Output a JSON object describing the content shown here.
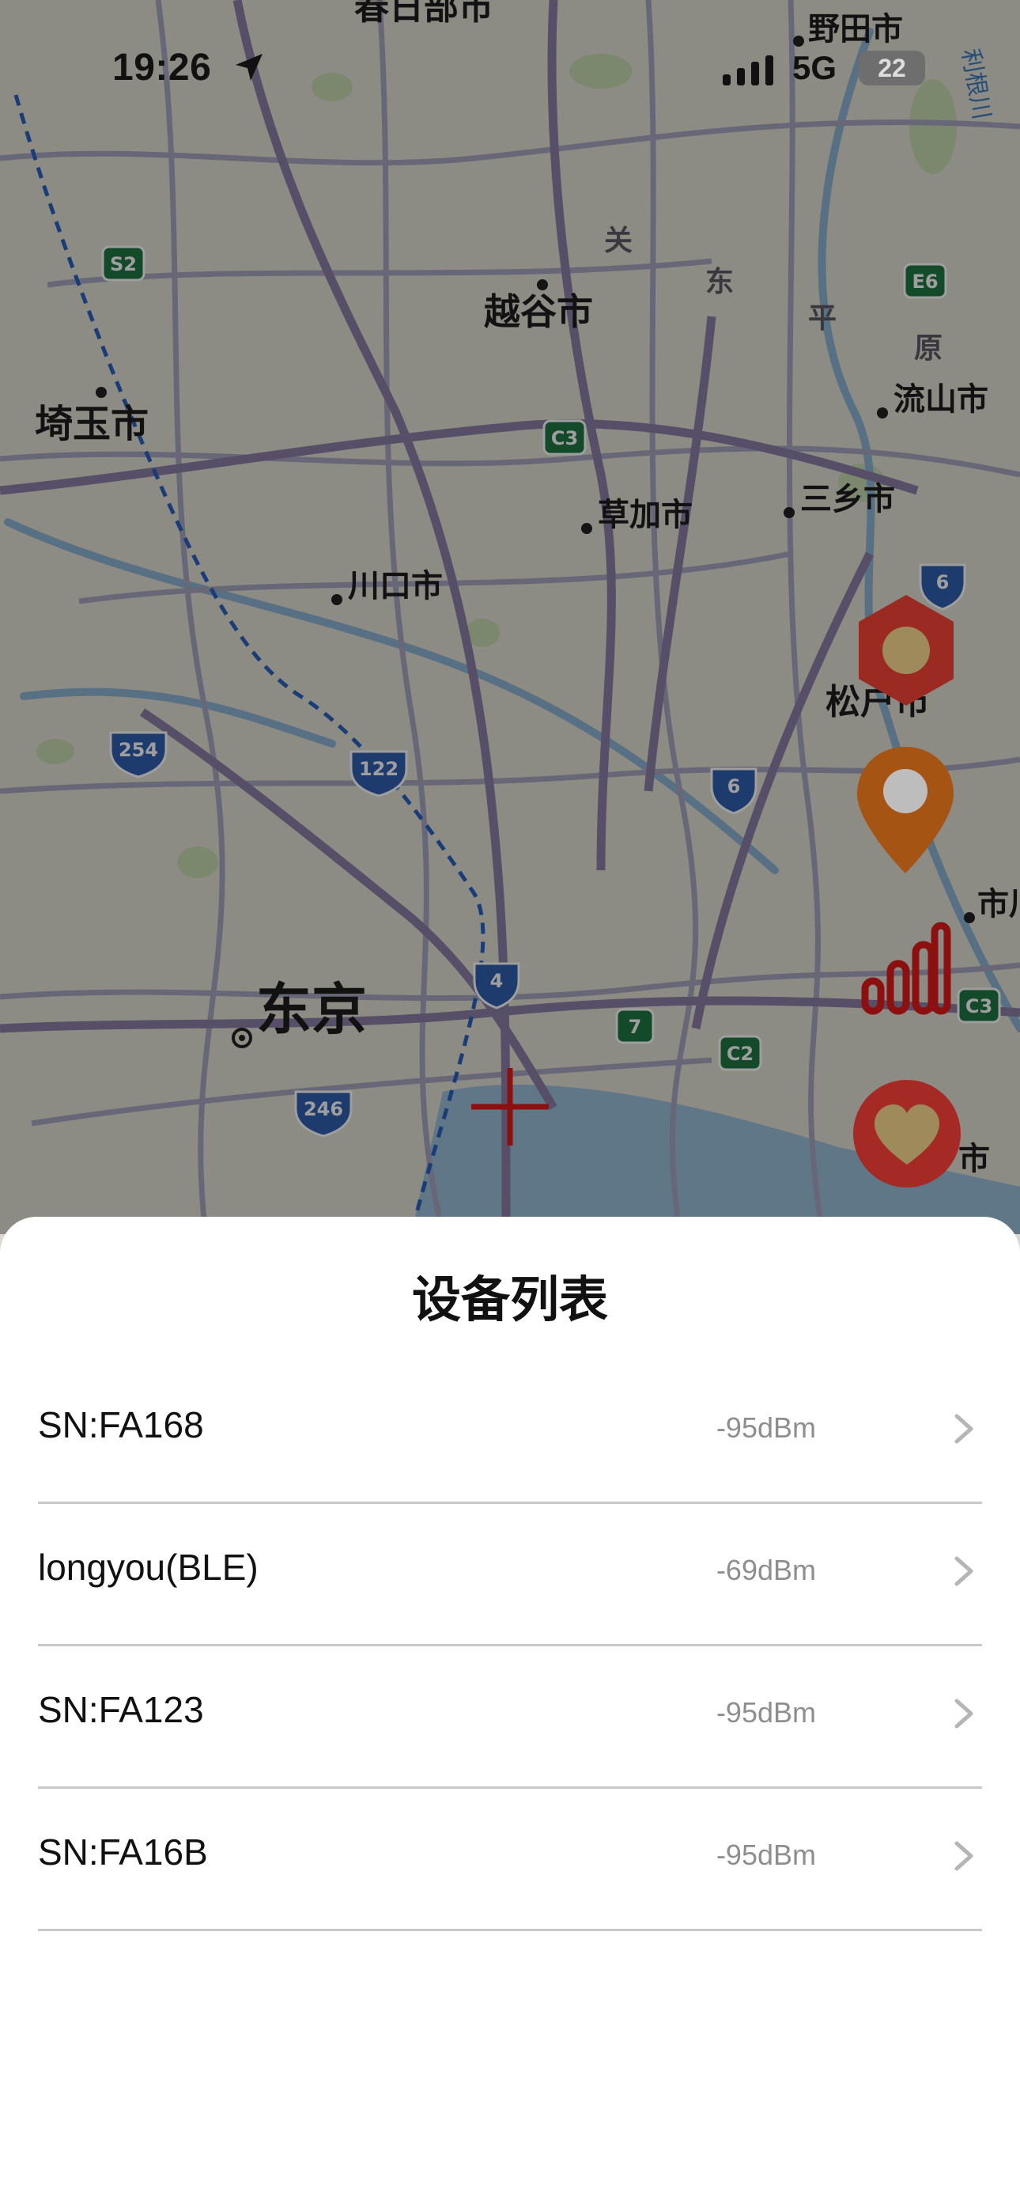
{
  "status_bar": {
    "time": "19:26",
    "network": "5G",
    "battery": "22"
  },
  "map": {
    "labels": {
      "kasukabe": "春日部市",
      "noda": "野田市",
      "koshigaya": "越谷市",
      "saitama": "埼玉市",
      "nagareyama": "流山市",
      "misato": "三乡市",
      "soka": "草加市",
      "kawaguchi": "川口市",
      "matsudo": "松户市",
      "tokyo": "东京",
      "ichikawa": "市川",
      "urayasu": "市",
      "kanto1": "关",
      "kanto2": "东",
      "kanto3": "平",
      "kanto4": "原",
      "river": "利根川"
    },
    "shields": {
      "s2": "S2",
      "e6": "E6",
      "c3a": "C3",
      "c3b": "C3",
      "c2": "C2",
      "r7": "7",
      "r6a": "6",
      "r6b": "6",
      "r4": "4",
      "r254": "254",
      "r122": "122",
      "r246": "246"
    },
    "accent_color": "#c0282c",
    "pin_color": "#c8640f"
  },
  "sheet": {
    "title": "设备列表",
    "devices": [
      {
        "name": "SN:FA168",
        "rssi": "-95dBm"
      },
      {
        "name": "longyou(BLE)",
        "rssi": "-69dBm"
      },
      {
        "name": "SN:FA123",
        "rssi": "-95dBm"
      },
      {
        "name": "SN:FA16B",
        "rssi": "-95dBm"
      }
    ]
  }
}
